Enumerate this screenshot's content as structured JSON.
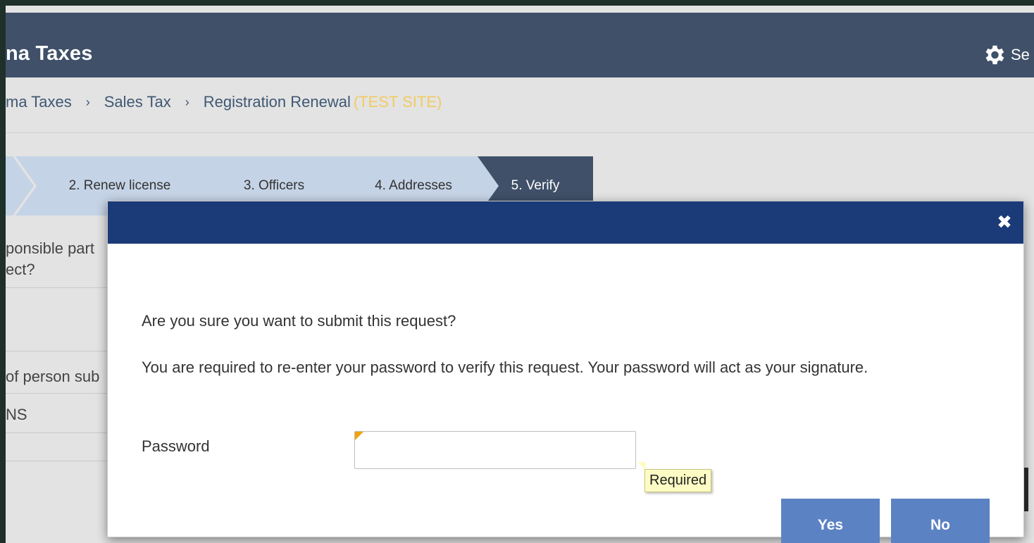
{
  "header": {
    "title": "na Taxes",
    "settings_label": "Se"
  },
  "breadcrumb": {
    "items": [
      "ma Taxes",
      "Sales Tax",
      "Registration Renewal"
    ],
    "separator": ">",
    "test_site": "(TEST SITE)"
  },
  "wizard": {
    "steps": [
      {
        "label": ""
      },
      {
        "label": "2. Renew license"
      },
      {
        "label": "3. Officers"
      },
      {
        "label": "4. Addresses"
      },
      {
        "label": "5. Verify"
      }
    ],
    "active_index": 4
  },
  "background": {
    "row1_line1": "ponsible part",
    "row1_line2": "ect?",
    "row2": "of person sub",
    "row3": "NS"
  },
  "modal": {
    "close_icon": "close-icon",
    "question": "Are you sure you want to submit this request?",
    "instruction": "You are required to re-enter your password to verify this request. Your password will act as your signature.",
    "password_label": "Password",
    "password_value": "",
    "required_tooltip": "Required",
    "yes_label": "Yes",
    "no_label": "No"
  },
  "colors": {
    "header_bg": "#3f5068",
    "modal_header_bg": "#1b3a78",
    "button_bg": "#5b82c3",
    "step_inactive": "#c5d3e6",
    "step_active": "#3f5068",
    "test_site": "#f1cb63",
    "tooltip_bg": "#fdfcc4"
  }
}
